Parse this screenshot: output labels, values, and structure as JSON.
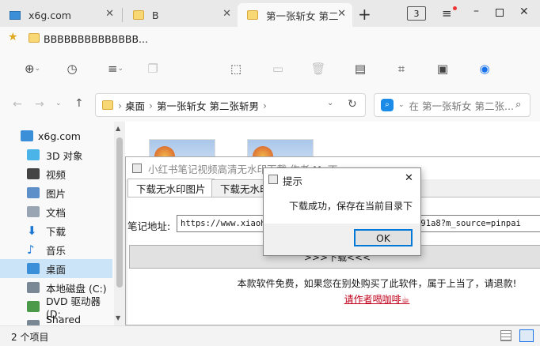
{
  "browser_tabs": [
    {
      "label": "x6g.com"
    },
    {
      "label": "B"
    },
    {
      "label": "第一张斩女 第二"
    }
  ],
  "tab_count": "3",
  "bookmark": {
    "label": "BBBBBBBBBBBBBB..."
  },
  "address": {
    "crumbs": [
      "桌面",
      "第一张斩女 第二张斩男"
    ]
  },
  "search": {
    "placeholder": "在 第一张斩女 第二张..."
  },
  "sidebar": {
    "items": [
      {
        "label": "x6g.com",
        "icon": "computer-icon",
        "color": "#3b8ed8"
      },
      {
        "label": "3D 对象",
        "icon": "cube-icon",
        "color": "#4ab3e8"
      },
      {
        "label": "视频",
        "icon": "video-icon",
        "color": "#444444"
      },
      {
        "label": "图片",
        "icon": "picture-icon",
        "color": "#5f8fc9"
      },
      {
        "label": "文档",
        "icon": "document-icon",
        "color": "#9aa5b3"
      },
      {
        "label": "下载",
        "icon": "download-icon",
        "color": "#1e79d4"
      },
      {
        "label": "音乐",
        "icon": "music-icon",
        "color": "#1e79d4"
      },
      {
        "label": "桌面",
        "icon": "desktop-icon",
        "color": "#3b8ed8",
        "selected": true
      },
      {
        "label": "本地磁盘 (C:)",
        "icon": "drive-icon",
        "color": "#7a8794"
      },
      {
        "label": "DVD 驱动器 (D:",
        "icon": "dvd-icon",
        "color": "#4a9a4a"
      },
      {
        "label": "Shared Folders",
        "icon": "shared-folder-icon",
        "color": "#7a8794"
      }
    ]
  },
  "status": {
    "items": "2 个项目"
  },
  "app": {
    "title": "小红书笔记视频高清无水印下载 作者:Mr.丁",
    "tabs": [
      "下载无水印图片",
      "下载无水印"
    ],
    "url_label": "笔记地址:",
    "url_value": "https://www.xiaohongshu.com/discovery/item/6270291a8?m_source=pinpai",
    "download_button": ">>>下载<<<",
    "notice": "本款软件免费，如果您在别处购买了此软件，属于上当了，请退款!",
    "coffee_link": "请作者喝咖啡☕"
  },
  "dialog": {
    "title": "提示",
    "message": "下载成功，保存在当前目录下",
    "ok": "OK"
  }
}
